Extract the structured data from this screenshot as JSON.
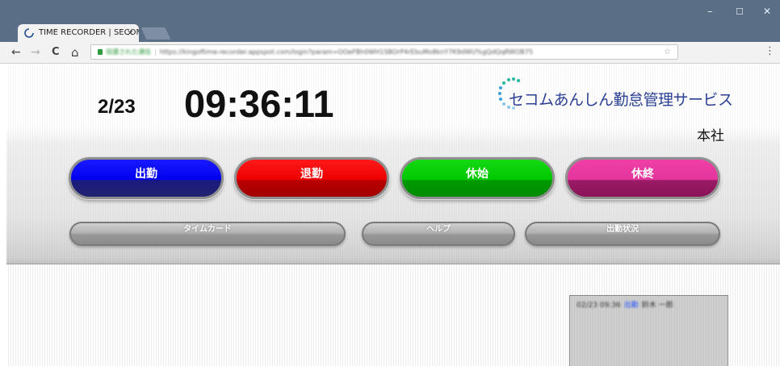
{
  "browser": {
    "tab_title": "TIME RECORDER | SECOM",
    "tab_close": "×",
    "window_controls": {
      "minimize": "–",
      "maximize": "☐",
      "close": "✕"
    },
    "nav": {
      "back": "←",
      "forward": "→",
      "reload": "C",
      "home": "⌂"
    },
    "address": {
      "secure_label": "保護された通信",
      "url": "https://kingoftime-recorder.appspot.com/login?param=OOeFBh0WH1SBOrP4rEbuMo8knY7K9dWU%gQdQqRWOB75"
    },
    "bookmark_icon": "star-icon",
    "menu_icon": "⋮"
  },
  "recorder": {
    "date": "2/23",
    "time": "09:36:11",
    "logo_text": "セコムあんしん勤怠管理サービス",
    "branch": "本社",
    "colors": {
      "clock_in": "#0000f0",
      "clock_out": "#ee0000",
      "break_start": "#00c800",
      "break_end": "#e3359c",
      "logo": "#2a3f93"
    },
    "buttons": {
      "clock_in": "出勤",
      "clock_out": "退勤",
      "break_start": "休始",
      "break_end": "休終"
    },
    "sub_buttons": {
      "timecard": "タイムカード",
      "help": "ヘルプ",
      "attendance_status": "出勤状況"
    },
    "log": [
      {
        "time": "02/23 09:36",
        "kind": "出勤",
        "name": "鈴木 一郎"
      }
    ]
  }
}
